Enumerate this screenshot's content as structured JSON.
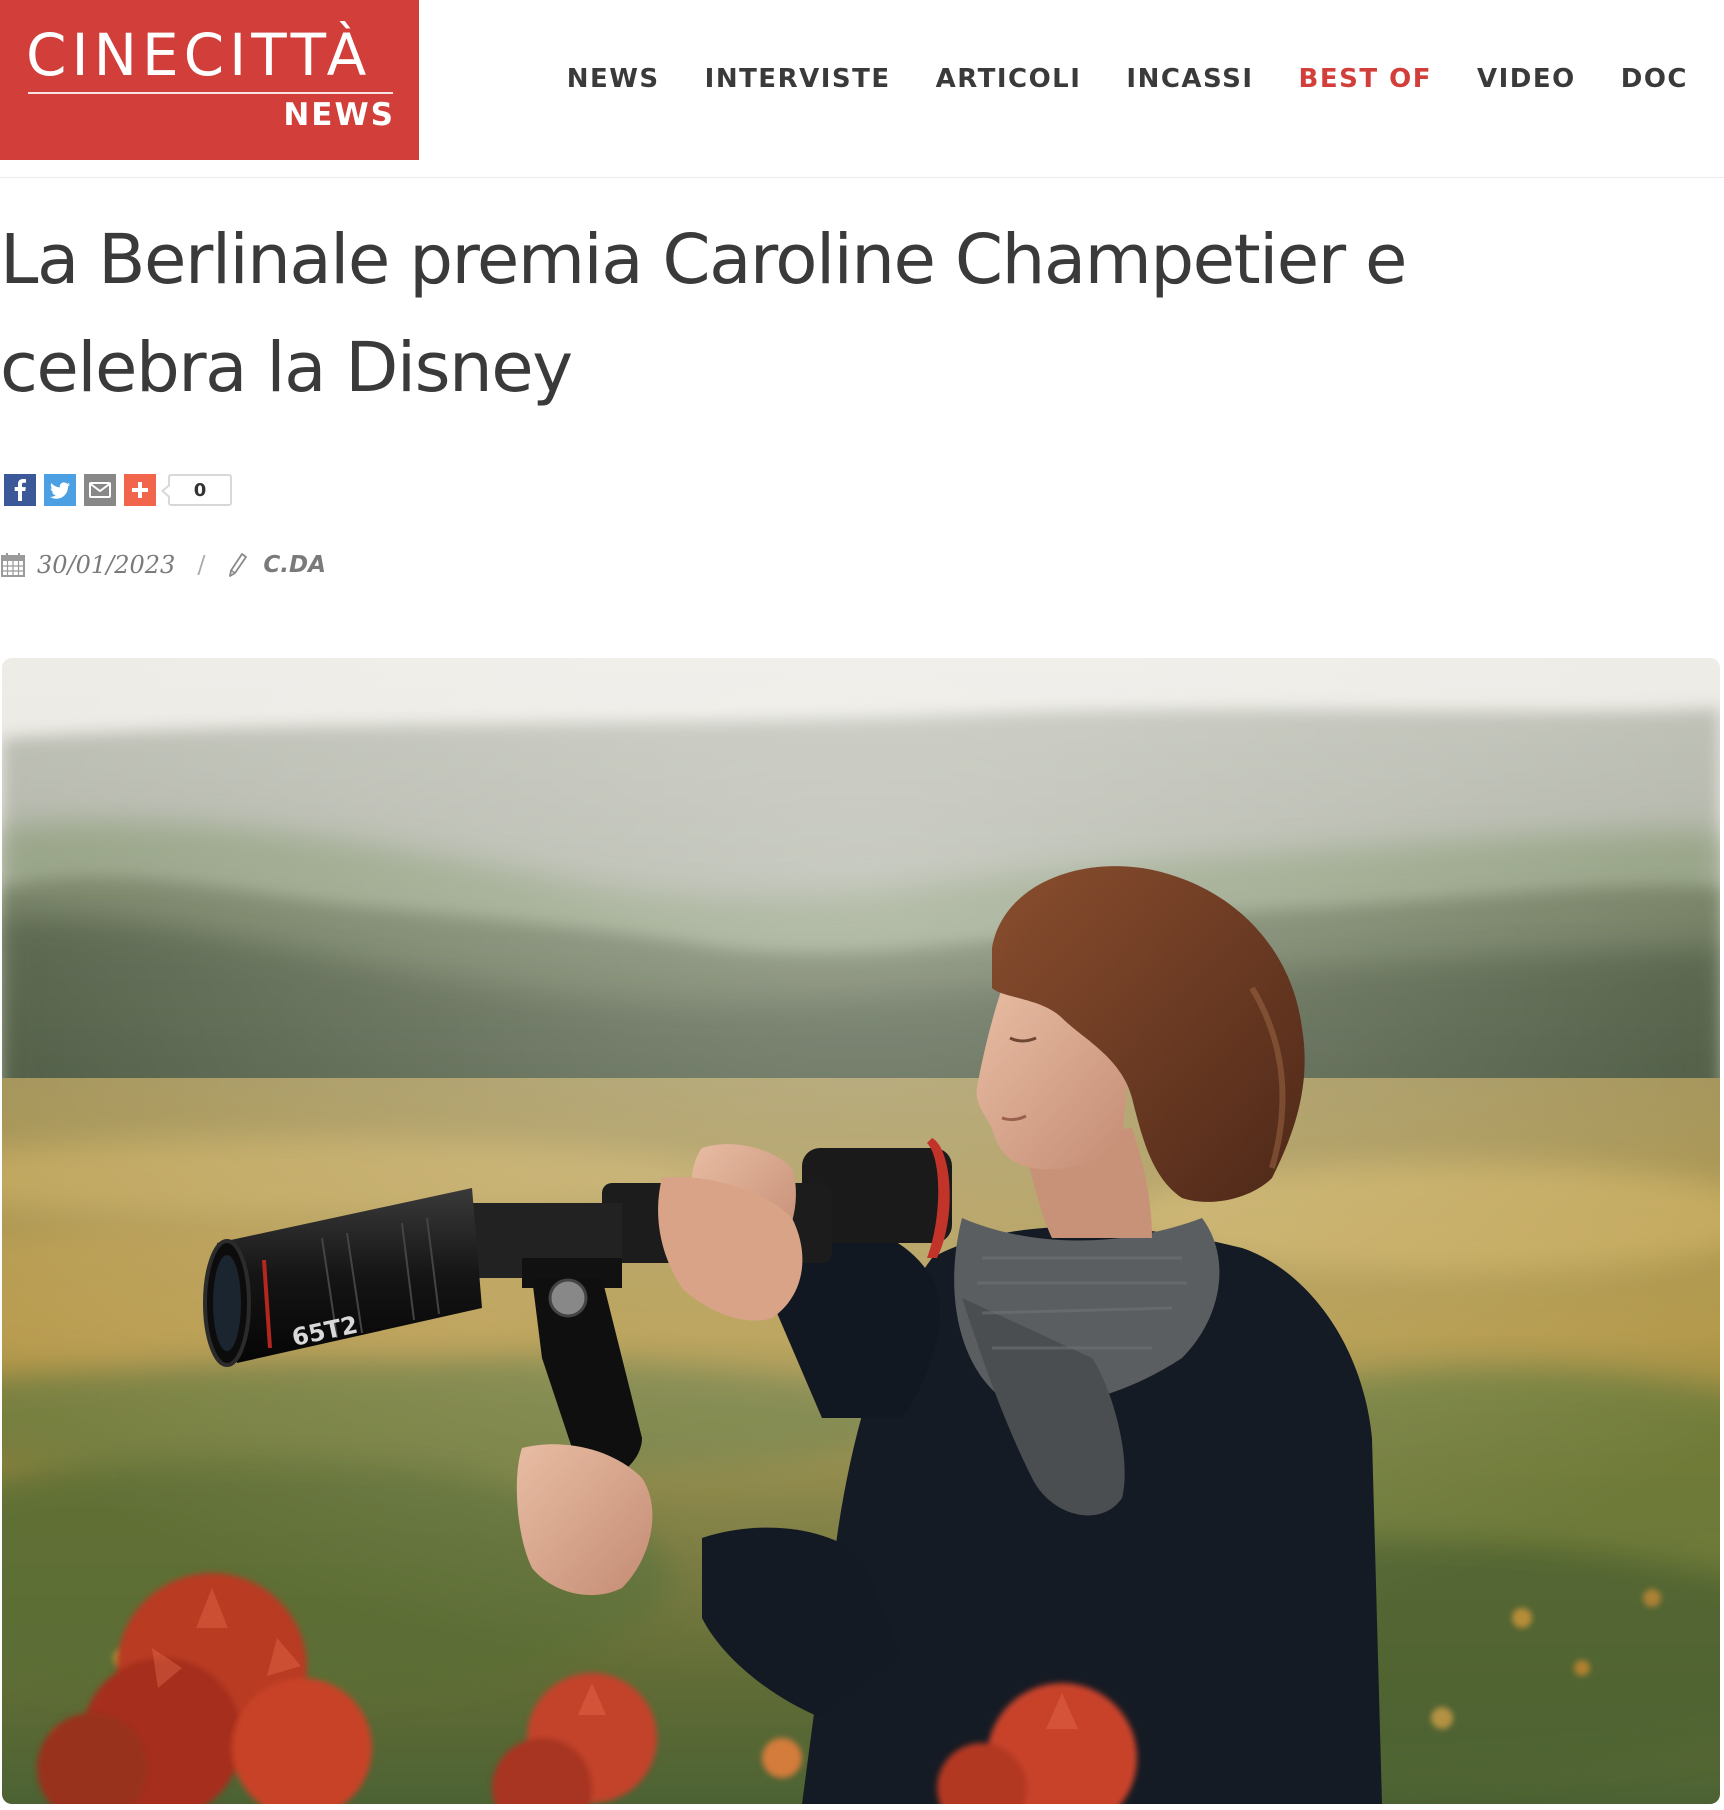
{
  "header": {
    "logo": {
      "main": "CINECITTÀ",
      "sub": "NEWS"
    },
    "nav": [
      {
        "label": "NEWS",
        "active": false
      },
      {
        "label": "INTERVISTE",
        "active": false
      },
      {
        "label": "ARTICOLI",
        "active": false
      },
      {
        "label": "INCASSI",
        "active": false
      },
      {
        "label": "BEST OF",
        "active": true
      },
      {
        "label": "VIDEO",
        "active": false
      },
      {
        "label": "DOC",
        "active": false
      }
    ]
  },
  "article": {
    "title": "La Berlinale premia Caroline Champetier e celebra la Disney",
    "share": {
      "icons": [
        "facebook-icon",
        "twitter-icon",
        "email-icon",
        "addthis-plus-icon"
      ],
      "count": "0"
    },
    "date": "30/01/2023",
    "date_separator": "/",
    "author": "C.DA",
    "hero_lens_text": "65T2"
  },
  "colors": {
    "brand_red": "#d23e3a",
    "nav_text": "#3a3a3a",
    "facebook": "#3b5998",
    "twitter": "#4ba0e3",
    "mail": "#888888",
    "addthis": "#f0654c"
  }
}
